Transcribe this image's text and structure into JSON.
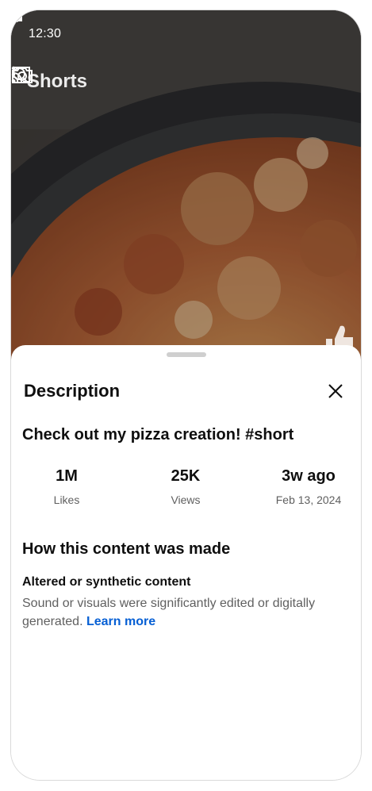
{
  "status_bar": {
    "time": "12:30"
  },
  "top_bar": {
    "title": "Shorts",
    "actions": [
      "cast-icon",
      "search-icon",
      "camera-icon",
      "more-vert-icon"
    ]
  },
  "sheet": {
    "title": "Description",
    "video_title": "Check out my pizza creation! #short",
    "stats": [
      {
        "value": "1M",
        "label": "Likes"
      },
      {
        "value": "25K",
        "label": "Views"
      },
      {
        "value": "3w ago",
        "label": "Feb 13, 2024"
      }
    ],
    "content_section": {
      "title": "How this content was made",
      "subtitle": "Altered or synthetic content",
      "description": "Sound or visuals were significantly edited or digitally generated.",
      "link_label": "Learn more"
    }
  },
  "colors": {
    "link": "#065fd4",
    "primary_text": "#0f0f0f",
    "secondary_text": "#606060"
  }
}
